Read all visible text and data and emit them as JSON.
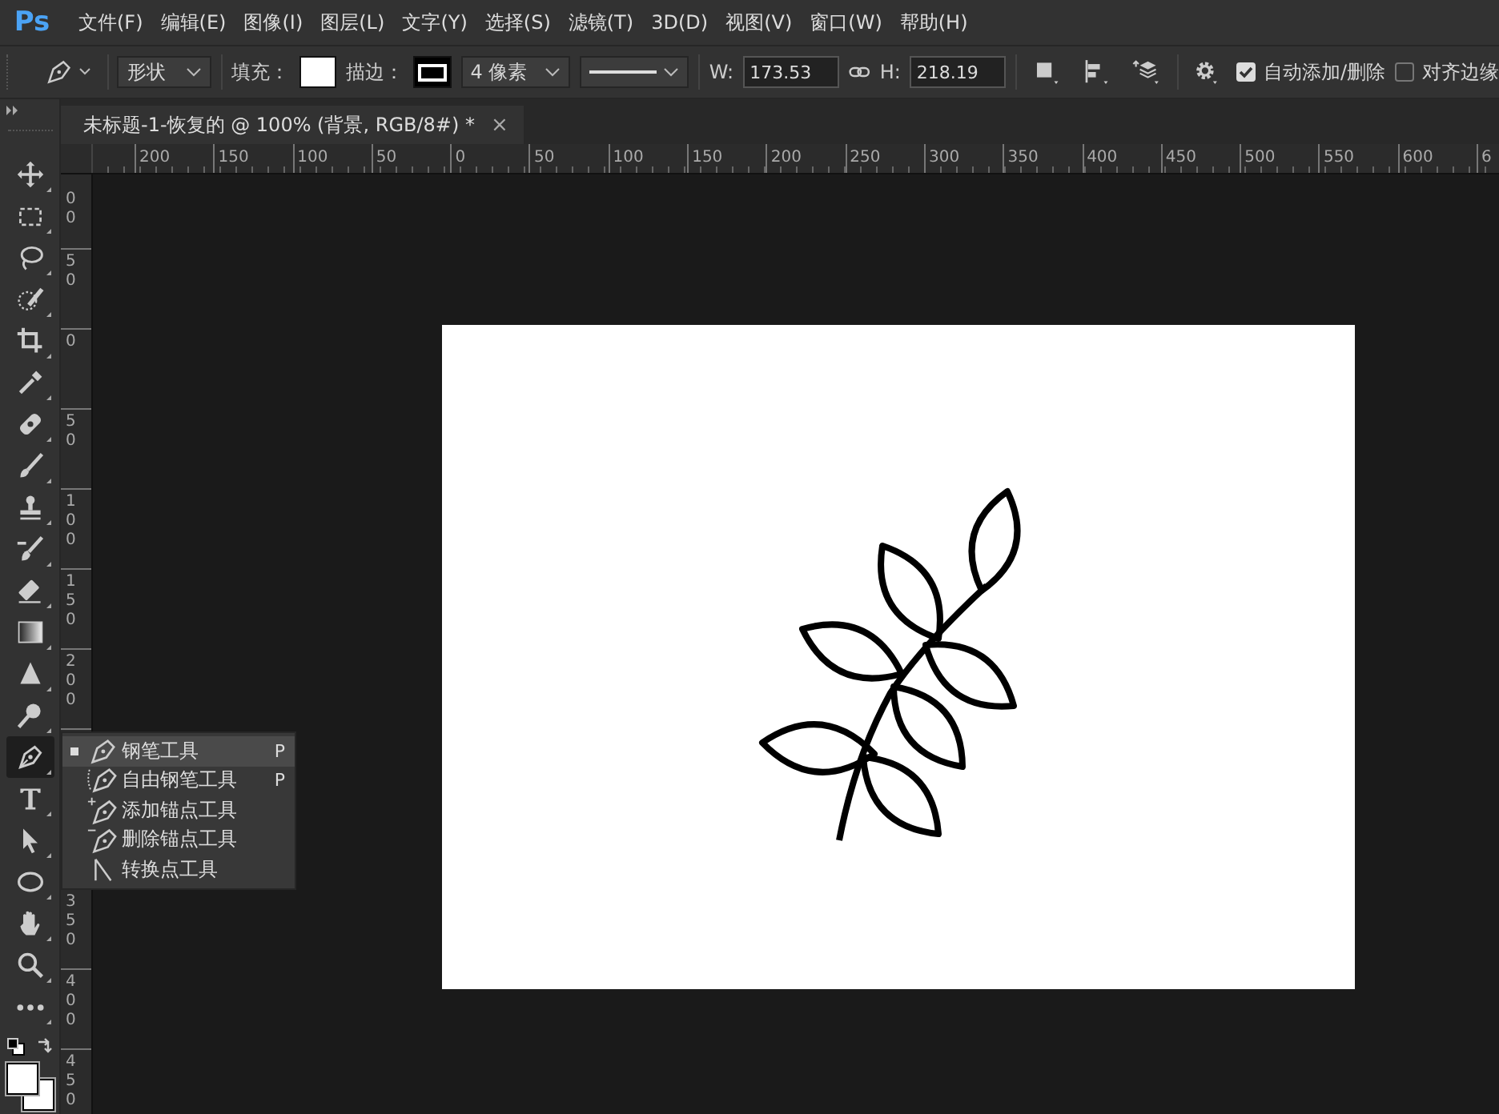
{
  "app": {
    "logo": "Ps"
  },
  "menu_bar": [
    "文件(F)",
    "编辑(E)",
    "图像(I)",
    "图层(L)",
    "文字(Y)",
    "选择(S)",
    "滤镜(T)",
    "3D(D)",
    "视图(V)",
    "窗口(W)",
    "帮助(H)"
  ],
  "options_bar": {
    "mode": "形状",
    "fill_label": "填充：",
    "stroke_label": "描边：",
    "stroke_width": "4 像素",
    "w_label": "W:",
    "w_value": "173.53",
    "h_label": "H:",
    "h_value": "218.19",
    "checkboxes": [
      {
        "label": "自动添加/删除",
        "checked": true
      },
      {
        "label": "对齐边缘",
        "checked": false
      }
    ]
  },
  "document_tab": {
    "title": "未标题-1-恢复的 @ 100% (背景, RGB/8#) *",
    "close": "×"
  },
  "tools": [
    {
      "kind": "move",
      "selected": false
    },
    {
      "kind": "marquee",
      "selected": false
    },
    {
      "kind": "lasso",
      "selected": false
    },
    {
      "kind": "quick-select",
      "selected": false
    },
    {
      "kind": "crop",
      "selected": false
    },
    {
      "kind": "eyedropper",
      "selected": false
    },
    {
      "kind": "healing",
      "selected": false
    },
    {
      "kind": "brush",
      "selected": false
    },
    {
      "kind": "stamp",
      "selected": false
    },
    {
      "kind": "history-brush",
      "selected": false
    },
    {
      "kind": "eraser",
      "selected": false
    },
    {
      "kind": "gradient",
      "selected": false
    },
    {
      "kind": "blur",
      "selected": false
    },
    {
      "kind": "dodge",
      "selected": false
    },
    {
      "kind": "pen",
      "selected": true
    },
    {
      "kind": "type",
      "selected": false
    },
    {
      "kind": "path-select",
      "selected": false
    },
    {
      "kind": "ellipse",
      "selected": false
    },
    {
      "kind": "hand",
      "selected": false
    },
    {
      "kind": "zoom",
      "selected": false
    },
    {
      "kind": "more",
      "selected": false
    }
  ],
  "ruler_horizontal": [
    "200",
    "150",
    "100",
    "50",
    "0",
    "50",
    "100",
    "150",
    "200",
    "250",
    "300",
    "350",
    "400",
    "450",
    "500",
    "550",
    "600",
    "6"
  ],
  "ruler_vertical": [
    "00",
    "50",
    "0",
    "50",
    "100",
    "150",
    "200",
    "350",
    "400",
    "450"
  ],
  "pen_menu": [
    {
      "kind": "pen",
      "label": "钢笔工具",
      "shortcut": "P",
      "selected": true
    },
    {
      "kind": "freeform-pen",
      "label": "自由钢笔工具",
      "shortcut": "P",
      "selected": false
    },
    {
      "kind": "add-anchor",
      "label": "添加锚点工具",
      "selected": false
    },
    {
      "kind": "delete-anchor",
      "label": "删除锚点工具",
      "selected": false
    },
    {
      "kind": "convert-point",
      "label": "转换点工具",
      "selected": false
    }
  ]
}
